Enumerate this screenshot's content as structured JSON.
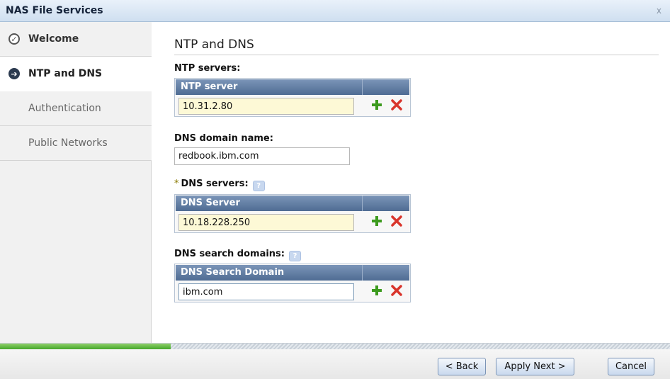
{
  "window": {
    "title": "NAS File Services",
    "close_label": "x"
  },
  "sidebar": {
    "items": [
      {
        "label": "Welcome",
        "state": "done",
        "icon": "check-circle-icon"
      },
      {
        "label": "NTP and DNS",
        "state": "active",
        "icon": "arrow-circle-icon"
      },
      {
        "label": "Authentication",
        "state": "pending"
      },
      {
        "label": "Public Networks",
        "state": "pending"
      }
    ]
  },
  "main": {
    "title": "NTP and DNS",
    "ntp": {
      "label": "NTP servers:",
      "column_header": "NTP server",
      "value": "10.31.2.80"
    },
    "dns_domain": {
      "label": "DNS domain name:",
      "value": "redbook.ibm.com"
    },
    "dns_servers": {
      "required_mark": "*",
      "label": "DNS servers:",
      "help": "?",
      "column_header": "DNS Server",
      "value": "10.18.228.250"
    },
    "dns_search": {
      "label": "DNS search domains:",
      "help": "?",
      "column_header": "DNS Search Domain",
      "value": "ibm.com"
    }
  },
  "progress": {
    "fraction": 0.255,
    "color": "#45a82b"
  },
  "footer": {
    "back_label": "< Back",
    "apply_next_label": "Apply Next >",
    "cancel_label": "Cancel"
  },
  "colors": {
    "accent": "#4f6c93",
    "add_icon": "#3c9a1e",
    "remove_icon": "#d9342b",
    "field_highlight": "#fdf9d6"
  }
}
